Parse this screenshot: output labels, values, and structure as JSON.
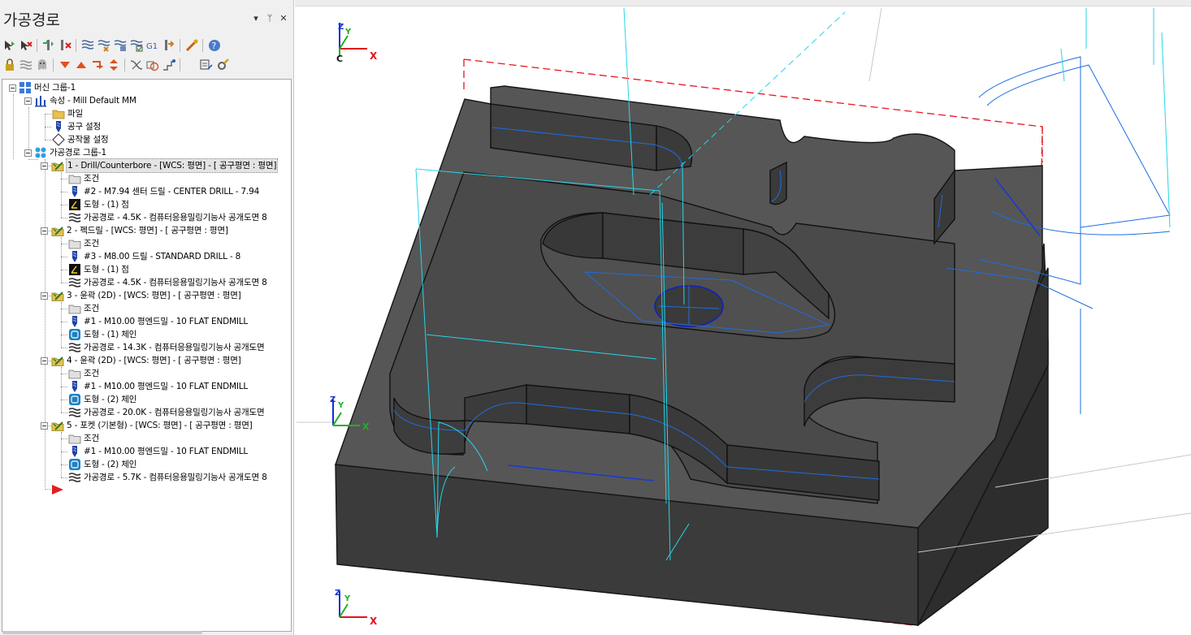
{
  "panel": {
    "title": "가공경로",
    "controls": {
      "dropdown": "▾",
      "pin": "ᛘ",
      "close": "✕"
    }
  },
  "toolbar": {
    "row1": [
      "select-all-ops-icon",
      "select-all-dirty-icon",
      "toggle-posting-icon",
      "toggle-hide-icon",
      "regenerate-all-icon",
      "regenerate-dirty-icon",
      "backplot-icon",
      "simulate-icon",
      "g1-post-icon",
      "post-selected-icon",
      "highspeed-icon",
      "help-icon"
    ],
    "row2": [
      "lock-icon",
      "lock-toolpath-icon",
      "hide-icon",
      "move-down-icon",
      "move-up-icon",
      "insert-arrow-icon",
      "expand-icon",
      "contrast-icon",
      "visibility-icon",
      "only-display-icon",
      "options-icon",
      "settings-icon"
    ],
    "g1_label": "G1"
  },
  "tree": {
    "machine_group": "머신 그룹-1",
    "properties": "속성 - Mill Default MM",
    "files": "파일",
    "tool_settings": "공구 설정",
    "stock_setup": "공작물 설정",
    "toolpath_group": "가공경로 그룹-1",
    "operations": [
      {
        "header": "1 - Drill/Counterbore - [WCS: 평면] - [ 공구평면 : 평면]",
        "selected": true,
        "params": "조건",
        "tool": "#2 - M7.94 센터 드릴 - CENTER DRILL - 7.94",
        "geometry": "도형 - (1) 점",
        "geometry_icon": "point-geometry-icon",
        "toolpath": "가공경로 - 4.5K - 컴퓨터응용밀링기능사 공개도면 8"
      },
      {
        "header": "2 - 펙드릴 - [WCS: 평면] - [ 공구평면 : 평면]",
        "selected": false,
        "params": "조건",
        "tool": "#3 - M8.00 드릴 - STANDARD DRILL - 8",
        "geometry": "도형 - (1) 점",
        "geometry_icon": "point-geometry-icon",
        "toolpath": "가공경로 - 4.5K - 컴퓨터응용밀링기능사 공개도면 8"
      },
      {
        "header": "3 - 윤곽 (2D) - [WCS: 평면] - [ 공구평면 : 평면]",
        "selected": false,
        "params": "조건",
        "tool": "#1 - M10.00 평엔드밀 - 10 FLAT ENDMILL",
        "geometry": "도형 - (1) 체인",
        "geometry_icon": "chain-geometry-icon",
        "toolpath": "가공경로 - 14.3K - 컴퓨터응용밀링기능사 공개도면"
      },
      {
        "header": "4 - 윤곽 (2D) - [WCS: 평면] - [ 공구평면 : 평면]",
        "selected": false,
        "params": "조건",
        "tool": "#1 - M10.00 평엔드밀 - 10 FLAT ENDMILL",
        "geometry": "도형 - (2) 체인",
        "geometry_icon": "chain-geometry-icon",
        "toolpath": "가공경로 - 20.0K - 컴퓨터응용밀링기능사 공개도면"
      },
      {
        "header": "5 - 포켓 (기본형) - [WCS: 평면] - [ 공구평면 : 평면]",
        "selected": false,
        "params": "조건",
        "tool": "#1 - M10.00 평엔드밀 - 10 FLAT ENDMILL",
        "geometry": "도형 - (2) 체인",
        "geometry_icon": "chain-geometry-icon",
        "toolpath": "가공경로 - 5.7K - 컴퓨터응용밀링기능사 공개도면 8"
      }
    ]
  },
  "viewport": {
    "gnomon_top": {
      "z": "Z",
      "y": "Y",
      "x": "X",
      "c": "C"
    },
    "gnomon_mid": {
      "z": "Z",
      "y": "Y",
      "x": "X"
    },
    "gnomon_bottom": {
      "z": "Z",
      "y": "Y",
      "x": "X"
    }
  },
  "colors": {
    "part_top": "#565656",
    "part_side": "#3b3b3b",
    "part_edge": "#151515",
    "toolpath_cyan": "#25d6ea",
    "toolpath_blue": "#1e6de0",
    "stock_boundary": "#e8141e",
    "axis_x": "#e0141e",
    "axis_y": "#20b020",
    "axis_z": "#1030d0",
    "selected_node_bg": "#e4e4e4",
    "op_insert_arrow": "#e02020"
  }
}
